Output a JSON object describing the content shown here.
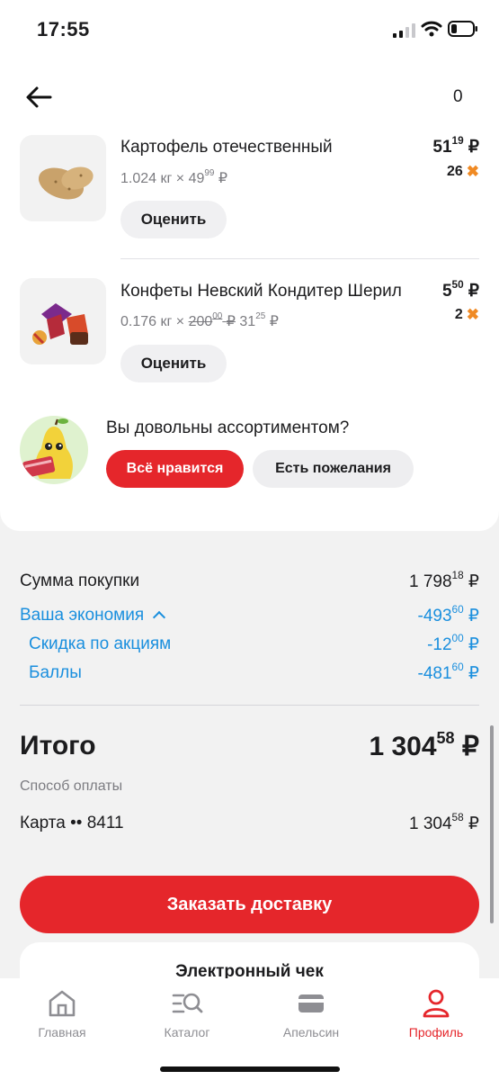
{
  "status": {
    "time": "17:55"
  },
  "header": {
    "cart_count": "0"
  },
  "products": [
    {
      "name": "Картофель отечественный",
      "qty": "1.024 кг",
      "times": "×",
      "unit_price_main": "49",
      "unit_price_cents": "99",
      "currency": "₽",
      "price_main": "51",
      "price_cents": "19",
      "points": "26",
      "rate_label": "Оценить"
    },
    {
      "name": "Конфеты Невский Кондитер Шерил",
      "qty": "0.176 кг",
      "times": "×",
      "old_price_main": "200",
      "old_price_cents": "00",
      "unit_price_main": "31",
      "unit_price_cents": "25",
      "currency": "₽",
      "price_main": "5",
      "price_cents": "50",
      "points": "2",
      "rate_label": "Оценить"
    }
  ],
  "survey": {
    "question": "Вы довольны ассортиментом?",
    "like_label": "Всё нравится",
    "wish_label": "Есть пожелания"
  },
  "summary": {
    "purchase_label": "Сумма покупки",
    "purchase_main": "1 798",
    "purchase_cents": "18",
    "savings_label": "Ваша экономия",
    "savings_main": "-493",
    "savings_cents": "60",
    "promo_label": "Скидка по акциям",
    "promo_main": "-12",
    "promo_cents": "00",
    "points_label": "Баллы",
    "points_main": "-481",
    "points_cents": "60",
    "currency": "₽"
  },
  "total": {
    "label": "Итого",
    "main": "1 304",
    "cents": "58",
    "currency": "₽",
    "payment_label": "Способ оплаты",
    "card_label": "Карта •• 8411",
    "card_main": "1 304",
    "card_cents": "58"
  },
  "actions": {
    "order_label": "Заказать доставку",
    "receipt_title": "Электронный чек"
  },
  "tabs": [
    {
      "label": "Главная",
      "icon": "home-icon"
    },
    {
      "label": "Каталог",
      "icon": "catalog-search-icon"
    },
    {
      "label": "Апельсин",
      "icon": "card-icon"
    },
    {
      "label": "Профиль",
      "icon": "profile-icon",
      "active": true
    }
  ],
  "colors": {
    "accent_red": "#e5262b",
    "link_blue": "#1a8fde",
    "points_orange": "#f08a24"
  }
}
